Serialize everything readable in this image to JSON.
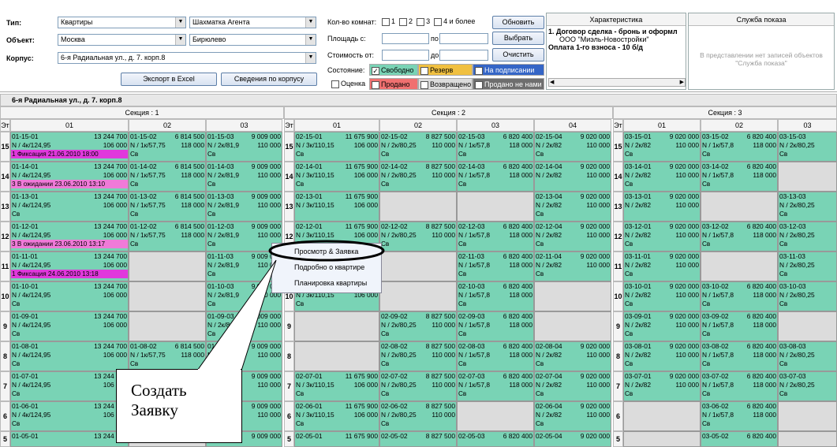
{
  "filters": {
    "type_label": "Тип:",
    "type_value": "Квартиры",
    "agent_value": "Шахматка Агента",
    "object_label": "Объект:",
    "object_value": "Москва",
    "district_value": "Бирюлево",
    "building_label": "Корпус:",
    "building_value": "6-я Радиальная ул., д. 7. корп.8",
    "export_label": "Экспорт в Excel",
    "info_label": "Сведения по корпусу",
    "rooms_label": "Кол-во комнат:",
    "rooms": [
      "1",
      "2",
      "3",
      "4 и более"
    ],
    "area_label": "Площадь с:",
    "area_to": "по",
    "price_label": "Стоимость от:",
    "price_to": "до",
    "refresh_label": "Обновить",
    "select_label": "Выбрать",
    "clear_label": "Очистить",
    "state_label": "Состояние:",
    "states": [
      {
        "label": "Свободно",
        "color": "#79d3b5",
        "checked": true
      },
      {
        "label": "Резерв",
        "color": "#f0c040",
        "checked": false
      },
      {
        "label": "На подписании",
        "color": "#3465c6",
        "checked": false
      },
      {
        "label": "Оценка",
        "color": "#ffffff",
        "checked": false
      },
      {
        "label": "Продано",
        "color": "#f07070",
        "checked": false
      },
      {
        "label": "Возвращено",
        "color": "#dcdcdc",
        "checked": false
      },
      {
        "label": "Продано не нами",
        "color": "#6e6e6e",
        "checked": false
      }
    ]
  },
  "characteristics": {
    "title": "Характеристика",
    "line1": "1. Договор сделка - бронь и оформл",
    "line2": "ООО \"Миэль-Новостройки\"",
    "line3": "Оплата 1-го взноса - 10 б/д"
  },
  "service": {
    "title": "Служба показа",
    "empty_text": "В представлении нет записей объектов \"Служба показа\""
  },
  "grid": {
    "title": "6-я Радиальная ул., д. 7. корп.8",
    "floor_label": "Эт",
    "sections": [
      {
        "label": "Секция : 1",
        "columns": [
          "01",
          "02",
          "03"
        ]
      },
      {
        "label": "Секция : 2",
        "columns": [
          "01",
          "02",
          "03",
          "04"
        ]
      },
      {
        "label": "Секция : 3",
        "columns": [
          "01",
          "02",
          "03"
        ]
      }
    ],
    "floors": [
      "15",
      "14",
      "13",
      "12",
      "11",
      "10",
      "9",
      "8",
      "7",
      "6",
      "5"
    ],
    "cells": [
      [
        "15|01-15-01|13 244 700|N / 4к/124,95|106 000|Св|fix:1 Фиксация 21.06.2010 18:00",
        "15|01-15-02|6 814 500|N / 1к/57,75|118 000|Св",
        "15|01-15-03|9 009 000|N / 2к/81,9|110 000|Св",
        "15|02-15-01|11 675 900|N / 3к/110,15|106 000|Св",
        "15|02-15-02|8 827 500|N / 2к/80,25|110 000|Св",
        "15|02-15-03|6 820 400|N / 1к/57,8|118 000|Св",
        "15|02-15-04|9 020 000|N / 2к/82|110 000|Св",
        "15|03-15-01|9 020 000|N / 2к/82|110 000|Св",
        "15|03-15-02|6 820 400|N / 1к/57,8|118 000|Св",
        "15|03-15-03||N / 2к/80,25||Св"
      ],
      [
        "14|01-14-01|13 244 700|N / 4к/124,95|106 000|Св|wait:3 В ожидании 23.06.2010 13:10",
        "14|01-14-02|6 814 500|N / 1к/57,75|118 000|Св",
        "14|01-14-03|9 009 000|N / 2к/81,9|110 000|Св",
        "14|02-14-01|11 675 900|N / 3к/110,15|106 000|Св",
        "14|02-14-02|8 827 500|N / 2к/80,25|110 000|Св",
        "14|02-14-03|6 820 400|N / 1к/57,8|118 000|Св",
        "14|02-14-04|9 020 000|N / 2к/82|110 000|",
        "14|03-14-01|9 020 000|N / 2к/82|110 000|Св",
        "14|03-14-02|6 820 400|N / 1к/57,8|118 000|Св",
        "off"
      ],
      [
        "13|01-13-01|13 244 700|N / 4к/124,95|106 000|Св",
        "13|01-13-02|6 814 500|N / 1к/57,75|118 000|Св",
        "13|01-13-03|9 009 000|N / 2к/81,9|110 000|Св",
        "13|02-13-01|11 675 900|N / 3к/110,15|106 000|",
        "off",
        "off",
        "13|02-13-04|9 020 000|N / 2к/82|110 000|Св",
        "13|03-13-01|9 020 000|N / 2к/82|110 000|",
        "off",
        "13|03-13-03||N / 2к/80,25||Св"
      ],
      [
        "12|01-12-01|13 244 700|N / 4к/124,95|106 000|Св|wait:3 В ожидании 23.06.2010 13:17",
        "12|01-12-02|6 814 500|N / 1к/57,75|118 000|Св",
        "12|01-12-03|9 009 000|N / 2к/81,9|110 000|Св",
        "12|02-12-01|11 675 900|N / 3к/110,15|106 000|Св",
        "12|02-12-02|8 827 500|N / 2к/80,25|110 000|Св",
        "12|02-12-03|6 820 400|N / 1к/57,8|118 000|Св",
        "12|02-12-04|9 020 000|N / 2к/82|110 000|Св",
        "12|03-12-01|9 020 000|N / 2к/82|110 000|Св",
        "12|03-12-02|6 820 400|N / 1к/57,8|118 000|Св",
        "12|03-12-03||N / 2к/80,25||Св"
      ],
      [
        "11|01-11-01|13 244 700|N / 4к/124,95|106 000|Св|fix:1 Фиксация 24.06.2010 13:18",
        "off",
        "11|01-11-03|9 009 000|N / 2к/81,9|110 000|Св",
        "off",
        "off",
        "11|02-11-03|6 820 400|N / 1к/57,8|118 000|Св",
        "11|02-11-04|9 020 000|N / 2к/82|110 000|Св",
        "11|03-11-01|9 020 000|N / 2к/82|110 000|Св",
        "off",
        "11|03-11-03||N / 2к/80,25||Св"
      ],
      [
        "10|01-10-01|13 244 700|N / 4к/124,95|106 000|Св",
        "off",
        "10|01-10-03|9 009 000|N / 2к/81,9|110 000|Св",
        "10|02-10-01|11 675 900|N / 3к/110,15|106 000|Св",
        "off",
        "10|02-10-03|6 820 400|N / 1к/57,8|118 000|Св",
        "off",
        "10|03-10-01|9 020 000|N / 2к/82|110 000|Св",
        "10|03-10-02|6 820 400|N / 1к/57,8|118 000|Св",
        "10|03-10-03||N / 2к/80,25||Св"
      ],
      [
        "9|01-09-01|13 244 700|N / 4к/124,95|106 000|Св",
        "off",
        "9|01-09-03|9 009 000|N / 2к/81,9|110 000|Св",
        "off",
        "9|02-09-02|8 827 500|N / 2к/80,25|110 000|Св",
        "9|02-09-03|6 820 400|N / 1к/57,8|118 000|Св",
        "off",
        "9|03-09-01|9 020 000|N / 2к/82|110 000|Св",
        "9|03-09-02|6 820 400|N / 1к/57,8|118 000|Св",
        "off"
      ],
      [
        "8|01-08-01|13 244 700|N / 4к/124,95|106 000|Св",
        "8|01-08-02|6 814 500|N / 1к/57,75|118 000|Св",
        "8|01-08-03|9 009 000|N / 2к/81,9|110 000|Св",
        "off",
        "8|02-08-02|8 827 500|N / 2к/80,25|110 000|Св",
        "8|02-08-03|6 820 400|N / 1к/57,8|118 000|Св",
        "8|02-08-04|9 020 000|N / 2к/82|110 000|Св",
        "8|03-08-01|9 020 000|N / 2к/82|110 000|Св",
        "8|03-08-02|6 820 400|N / 1к/57,8|118 000|Св",
        "8|03-08-03||N / 2к/80,25||Св"
      ],
      [
        "7|01-07-01|13 244 700|N / 4к/124,95|106 000|Св",
        "off",
        "7|01-07-03|9 009 000|N / 2к/81,9|110 000|Св",
        "7|02-07-01|11 675 900|N / 3к/110,15|106 000|Св",
        "7|02-07-02|8 827 500|N / 2к/80,25|110 000|Св",
        "7|02-07-03|6 820 400|N / 1к/57,8|118 000|Св",
        "7|02-07-04|9 020 000|N / 2к/82|110 000|Св",
        "7|03-07-01|9 020 000|N / 2к/82|110 000|Св",
        "7|03-07-02|6 820 400|N / 1к/57,8|118 000|Св",
        "7|03-07-03||N / 2к/80,25||Св"
      ],
      [
        "6|01-06-01|13 244 700|N / 4к/124,95|106 000|Св",
        "off",
        "6|01-06-03|9 009 000|N / 2к/81,9|110 000|Св",
        "6|02-06-01|11 675 900|N / 3к/110,15|106 000|Св",
        "6|02-06-02|8 827 500|N / 2к/80,25|110 000|Св",
        "off",
        "6|02-06-04|9 020 000|N / 2к/82|110 000|Св",
        "off",
        "6|03-06-02|6 820 400|N / 1к/57,8|118 000|Св",
        "off"
      ],
      [
        "5|01-05-01|13 244 700|||",
        "off",
        "5|01-05-03|9 009 000|||",
        "5|02-05-01|11 675 900|||",
        "5|02-05-02|8 827 500|||",
        "5|02-05-03|6 820 400|||",
        "5|02-05-04|9 020 000|||",
        "off",
        "5|03-05-02|6 820 400|||",
        "off"
      ]
    ]
  },
  "context_menu": {
    "items": [
      "Просмотр & Заявка",
      "Подробно о квартире",
      "Планировка квартиры"
    ]
  },
  "callout": {
    "line1": "Создать",
    "line2": "Заявку"
  }
}
